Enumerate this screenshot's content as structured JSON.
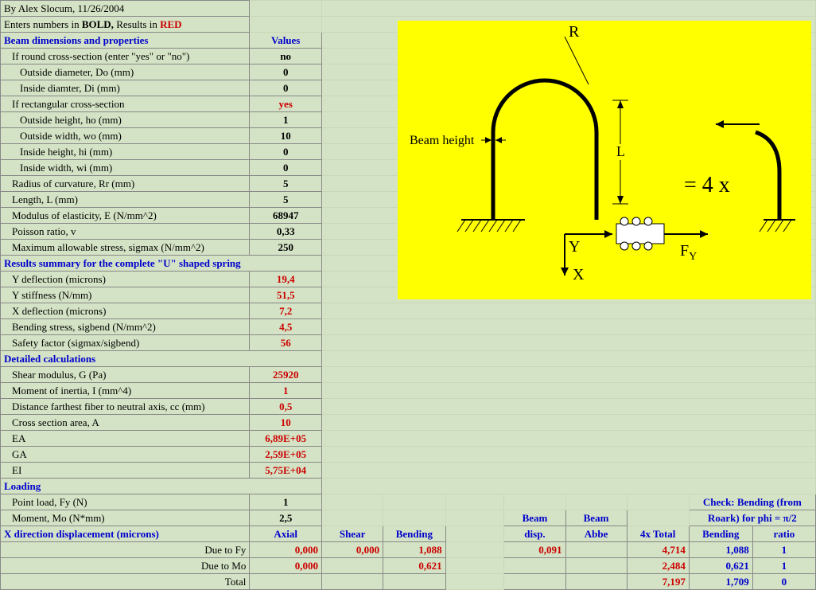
{
  "header": {
    "author_line": "By Alex Slocum, 11/26/2004",
    "instructions_pre": "Enters numbers in ",
    "instructions_bold": "BOLD, ",
    "instructions_results": "Results in ",
    "instructions_red": "RED"
  },
  "dims": {
    "title": "Beam dimensions and properties",
    "values_label": "Values",
    "round_label": "If round cross-section (enter \"yes\" or \"no\")",
    "round_val": "no",
    "do_label": "Outside diameter, Do (mm)",
    "do_val": "0",
    "di_label": "Inside diamter, Di (mm)",
    "di_val": "0",
    "rect_label": "If rectangular cross-section",
    "rect_val": "yes",
    "ho_label": "Outside height, ho (mm)",
    "ho_val": "1",
    "wo_label": "Outside width, wo (mm)",
    "wo_val": "10",
    "hi_label": "Inside height, hi (mm)",
    "hi_val": "0",
    "wi_label": "Inside width, wi (mm)",
    "wi_val": "0",
    "rr_label": "Radius of curvature, Rr (mm)",
    "rr_val": "5",
    "l_label": "Length, L (mm)",
    "l_val": "5",
    "e_label": "Modulus of elasticity, E (N/mm^2)",
    "e_val": "68947",
    "v_label": "Poisson ratio, v",
    "v_val": "0,33",
    "sig_label": "Maximum allowable stress, sigmax (N/mm^2)",
    "sig_val": "250"
  },
  "results": {
    "title": "Results summary for the complete \"U\" shaped spring",
    "ydefl_label": "Y deflection (microns)",
    "ydefl_val": "19,4",
    "ystiff_label": "Y stiffness (N/mm)",
    "ystiff_val": "51,5",
    "xdefl_label": "X deflection (microns)",
    "xdefl_val": "7,2",
    "bend_label": "Bending stress, sigbend (N/mm^2)",
    "bend_val": "4,5",
    "sf_label": "Safety factor (sigmax/sigbend)",
    "sf_val": "56"
  },
  "detailed": {
    "title": "Detailed calculations",
    "g_label": "Shear modulus, G (Pa)",
    "g_val": "25920",
    "i_label": "Moment of inertia, I (mm^4)",
    "i_val": "1",
    "cc_label": "Distance farthest fiber to neutral axis, cc (mm)",
    "cc_val": "0,5",
    "a_label": "Cross section area, A",
    "a_val": "10",
    "ea_label": "EA",
    "ea_val": "6,89E+05",
    "ga_label": "GA",
    "ga_val": "2,59E+05",
    "ei_label": "EI",
    "ei_val": "5,75E+04"
  },
  "loading": {
    "title": "Loading",
    "fy_label": "Point load, Fy (N)",
    "fy_val": "1",
    "mo_label": "Moment, Mo (N*mm)",
    "mo_val": "2,5"
  },
  "xdisp": {
    "title": "X direction displacement (microns)",
    "axial": "Axial",
    "shear": "Shear",
    "bending": "Bending",
    "beam_disp1": "Beam",
    "beam_disp2": "disp.",
    "beam_abbe1": "Beam",
    "beam_abbe2": "Abbe",
    "x4total": "4x Total",
    "check1": "Check: Bending (from",
    "check2": "Roark) for phi = π/2",
    "check_bending": "Bending",
    "check_ratio": "ratio",
    "fy_label": "Due to Fy",
    "mo_label": "Due to Mo",
    "total_label": "Total",
    "fy": {
      "axial": "0,000",
      "shear": "0,000",
      "bending": "1,088",
      "disp": "0,091",
      "abbe": "",
      "total": "4,714",
      "cbend": "1,088",
      "cratio": "1"
    },
    "mo": {
      "axial": "0,000",
      "shear": "",
      "bending": "0,621",
      "disp": "",
      "abbe": "",
      "total": "2,484",
      "cbend": "0,621",
      "cratio": "1"
    },
    "tot": {
      "total": "7,197",
      "cbend": "1,709",
      "cratio": "0"
    }
  },
  "diagram": {
    "beam_height": "Beam height",
    "r": "R",
    "l": "L",
    "x": "X",
    "y": "Y",
    "fy": "F",
    "fysub": "Y",
    "eq": "= 4 x"
  }
}
